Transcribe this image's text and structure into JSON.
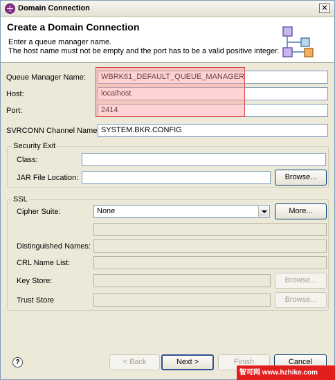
{
  "window": {
    "title": "Domain Connection"
  },
  "header": {
    "title": "Create a Domain Connection",
    "message_line1": "Enter a queue manager name.",
    "message_line2": "The host name must not be empty and the port has to be a valid positive integer."
  },
  "form": {
    "queue_manager_label": "Queue Manager Name:",
    "queue_manager_value": "WBRK61_DEFAULT_QUEUE_MANAGER",
    "host_label": "Host:",
    "host_value": "localhost",
    "port_label": "Port:",
    "port_value": "2414",
    "svrconn_label": "SVRCONN Channel Name:",
    "svrconn_value": "SYSTEM.BKR.CONFIG"
  },
  "security_exit": {
    "legend": "Security Exit",
    "class_label": "Class:",
    "class_value": "",
    "jar_label": "JAR File Location:",
    "jar_value": "",
    "browse_label": "Browse..."
  },
  "ssl": {
    "legend": "SSL",
    "cipher_label": "Cipher Suite:",
    "cipher_value": "None",
    "more_label": "More...",
    "dn_label": "Distinguished Names:",
    "crl_label": "CRL Name List:",
    "keystore_label": "Key Store:",
    "keystore_browse": "Browse...",
    "truststore_label": "Trust Store",
    "truststore_browse": "Browse..."
  },
  "buttons": {
    "back": "< Back",
    "next": "Next >",
    "finish": "Finish",
    "cancel": "Cancel"
  },
  "help": {
    "glyph": "?"
  },
  "watermark": {
    "text": "智可网 www.hzhike.com"
  },
  "colors": {
    "highlight": "#ff9696",
    "window_bg": "#ece9d8",
    "brand_icon": "#8a2d8d"
  }
}
